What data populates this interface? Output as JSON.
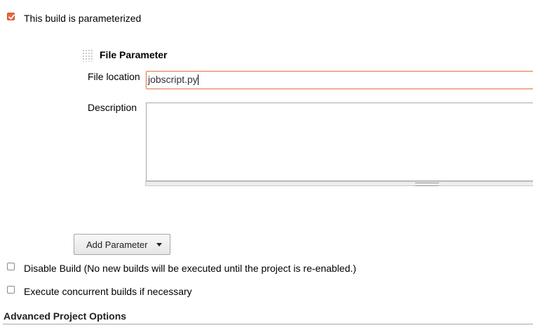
{
  "parameterized": {
    "label": "This build is parameterized",
    "checked": true
  },
  "file_parameter": {
    "title": "File Parameter",
    "file_location_label": "File location",
    "file_location_value": "jobscript.py",
    "description_label": "Description",
    "description_value": ""
  },
  "add_parameter": {
    "label": "Add Parameter"
  },
  "disable_build": {
    "label": "Disable Build (No new builds will be executed until the project is re-enabled.)",
    "checked": false
  },
  "concurrent_builds": {
    "label": "Execute concurrent builds if necessary",
    "checked": false
  },
  "advanced_section": {
    "title": "Advanced Project Options"
  },
  "colors": {
    "accent": "#e8683b",
    "focus_border": "#e07a50"
  }
}
